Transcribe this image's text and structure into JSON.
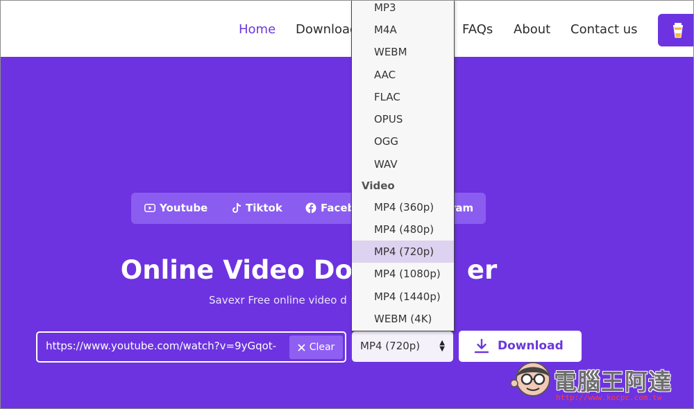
{
  "nav": {
    "home": "Home",
    "download": "Download",
    "faqs": "FAQs",
    "about": "About",
    "contact": "Contact us"
  },
  "platforms": [
    {
      "label": "Youtube",
      "icon": "youtube-icon"
    },
    {
      "label": "Tiktok",
      "icon": "tiktok-icon"
    },
    {
      "label": "Faceb",
      "icon": "facebook-icon"
    },
    {
      "label": "ram",
      "icon": "instagram-icon"
    }
  ],
  "hero": {
    "title_left": "Online Video Do",
    "title_right": "er",
    "subtitle": "Savexr Free online video d"
  },
  "url_input": {
    "value": "https://www.youtube.com/watch?v=9yGqot-"
  },
  "clear_label": "Clear",
  "format_select": {
    "value": "MP4 (720p)"
  },
  "download_label": "Download",
  "dropdown": {
    "audio_options": [
      "MP3",
      "M4A",
      "WEBM",
      "AAC",
      "FLAC",
      "OPUS",
      "OGG",
      "WAV"
    ],
    "video_group": "Video",
    "video_options": [
      "MP4 (360p)",
      "MP4 (480p)",
      "MP4 (720p)",
      "MP4 (1080p)",
      "MP4 (1440p)",
      "WEBM (4K)"
    ],
    "selected": "MP4 (720p)"
  },
  "watermark": {
    "text": "電腦王阿達",
    "url": "http://www.kocpc.com.tw"
  },
  "colors": {
    "brand_purple": "#6d33e0",
    "tab_bar": "#8a5df0",
    "selected_option": "#ddd2ef"
  }
}
